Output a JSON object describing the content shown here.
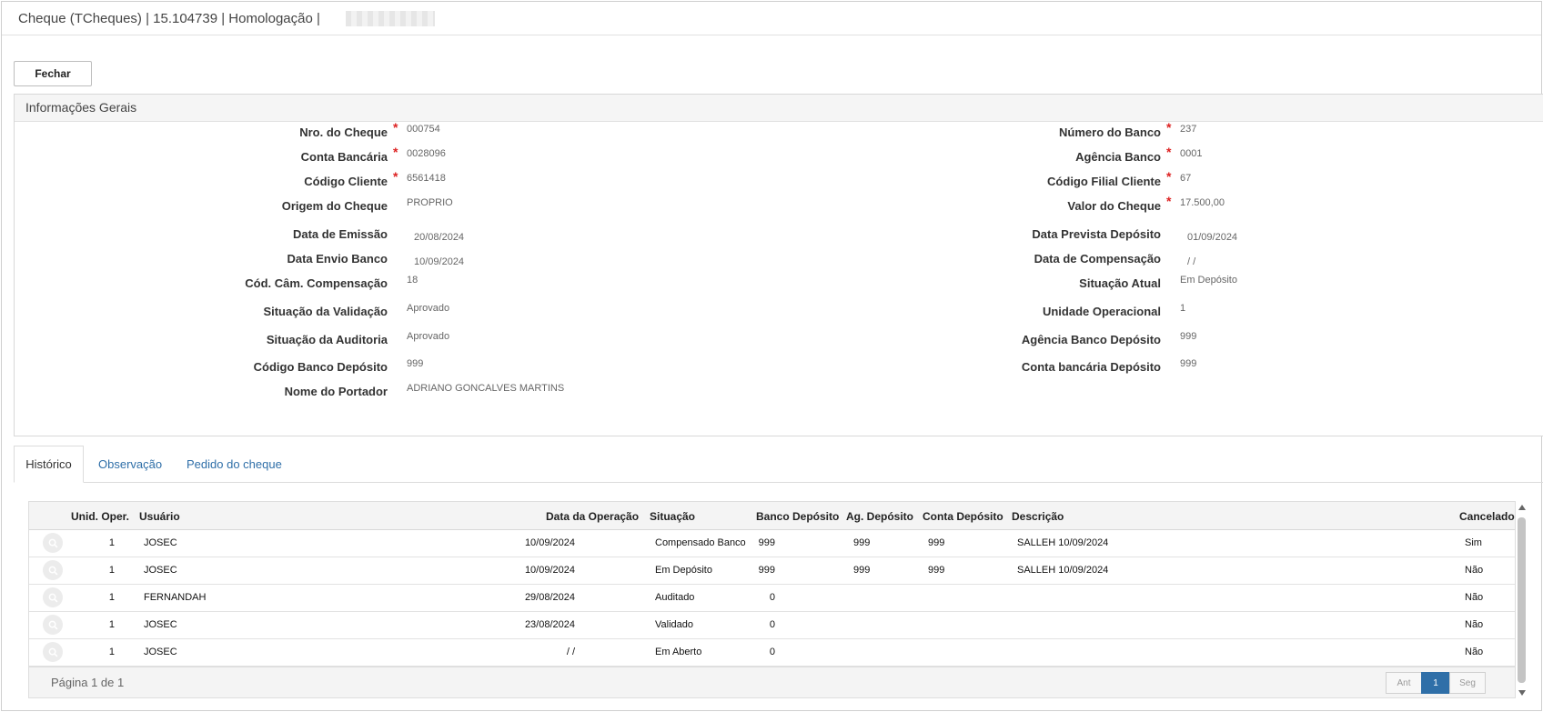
{
  "window": {
    "title": "Cheque (TCheques) | 15.104739 | Homologação |"
  },
  "toolbar": {
    "fechar_label": "Fechar"
  },
  "panel": {
    "title": "Informações Gerais",
    "left_fields": [
      {
        "label": "Nro. do Cheque",
        "value": "000754",
        "required": true
      },
      {
        "label": "Conta Bancária",
        "value": "0028096",
        "required": true
      },
      {
        "label": "Código Cliente",
        "value": "6561418",
        "required": true
      },
      {
        "label": "Origem do Cheque",
        "value": "PROPRIO",
        "required": false
      },
      {
        "label": "Data de Emissão",
        "value": "20/08/2024",
        "required": false
      },
      {
        "label": "Data Envio Banco",
        "value": "10/09/2024",
        "required": false
      },
      {
        "label": "Cód. Câm. Compensação",
        "value": "18",
        "required": false
      },
      {
        "label": "Situação da Validação",
        "value": "Aprovado",
        "required": false
      },
      {
        "label": "Situação da Auditoria",
        "value": "Aprovado",
        "required": false
      },
      {
        "label": "Código Banco Depósito",
        "value": "999",
        "required": false
      },
      {
        "label": "Nome do Portador",
        "value": "ADRIANO GONCALVES MARTINS",
        "required": false
      }
    ],
    "right_fields": [
      {
        "label": "Número do Banco",
        "value": "237",
        "required": true
      },
      {
        "label": "Agência Banco",
        "value": "0001",
        "required": true
      },
      {
        "label": "Código Filial Cliente",
        "value": "67",
        "required": true
      },
      {
        "label": "Valor do Cheque",
        "value": "17.500,00",
        "required": true
      },
      {
        "label": "Data Prevista Depósito",
        "value": "01/09/2024",
        "required": false
      },
      {
        "label": "Data de Compensação",
        "value": "/ /",
        "required": false
      },
      {
        "label": "Situação Atual",
        "value": "Em Depósito",
        "required": false
      },
      {
        "label": "Unidade Operacional",
        "value": "1",
        "required": false
      },
      {
        "label": "Agência Banco Depósito",
        "value": "999",
        "required": false
      },
      {
        "label": "Conta bancária Depósito",
        "value": "999",
        "required": false
      }
    ]
  },
  "tabs": [
    "Histórico",
    "Observação",
    "Pedido do cheque"
  ],
  "grid": {
    "columns": [
      "Unid. Oper.",
      "Usuário",
      "Data da Operação",
      "Situação",
      "Banco Depósito",
      "Ag. Depósito",
      "Conta Depósito",
      "Descrição",
      "Cancelado"
    ],
    "rows": [
      {
        "unid": "1",
        "usuario": "JOSEC",
        "data": "10/09/2024",
        "situacao": "Compensado Banco",
        "banco": "999",
        "ag": "999",
        "conta": "999",
        "descricao": "SALLEH 10/09/2024",
        "cancelado": "Sim"
      },
      {
        "unid": "1",
        "usuario": "JOSEC",
        "data": "10/09/2024",
        "situacao": "Em Depósito",
        "banco": "999",
        "ag": "999",
        "conta": "999",
        "descricao": "SALLEH 10/09/2024",
        "cancelado": "Não"
      },
      {
        "unid": "1",
        "usuario": "FERNANDAH",
        "data": "29/08/2024",
        "situacao": "Auditado",
        "banco": "0",
        "ag": "",
        "conta": "",
        "descricao": "",
        "cancelado": "Não"
      },
      {
        "unid": "1",
        "usuario": "JOSEC",
        "data": "23/08/2024",
        "situacao": "Validado",
        "banco": "0",
        "ag": "",
        "conta": "",
        "descricao": "",
        "cancelado": "Não"
      },
      {
        "unid": "1",
        "usuario": "JOSEC",
        "data": "/ /",
        "situacao": "Em Aberto",
        "banco": "0",
        "ag": "",
        "conta": "",
        "descricao": "",
        "cancelado": "Não"
      }
    ],
    "page_info": "Página 1 de 1",
    "pager": {
      "prev": "Ant",
      "current": "1",
      "next": "Seg"
    }
  },
  "icons": {
    "row_action": "search-icon",
    "required_marker": "asterisk"
  },
  "colors": {
    "link": "#2f6fa8",
    "required": "#dd2222",
    "pager_active": "#2f6fa8"
  }
}
